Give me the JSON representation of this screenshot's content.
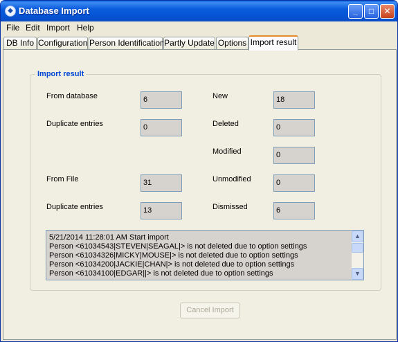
{
  "window": {
    "title": "Database Import"
  },
  "titlebar_buttons": {
    "minimize": "_",
    "maximize": "□",
    "close": "✕"
  },
  "menu": {
    "file": "File",
    "edit": "Edit",
    "import": "Import",
    "help": "Help"
  },
  "tabs": [
    "DB Info",
    "Configuration",
    "Person Identification",
    "Partly Update",
    "Options",
    "Import result"
  ],
  "active_tab": "Import result",
  "group": {
    "title": "Import result"
  },
  "fields": {
    "from_database": {
      "label": "From database",
      "value": "6"
    },
    "duplicate_db": {
      "label": "Duplicate entries",
      "value": "0"
    },
    "from_file": {
      "label": "From File",
      "value": "31"
    },
    "duplicate_file": {
      "label": "Duplicate entries",
      "value": "13"
    },
    "new": {
      "label": "New",
      "value": "18"
    },
    "deleted": {
      "label": "Deleted",
      "value": "0"
    },
    "modified": {
      "label": "Modified",
      "value": "0"
    },
    "unmodified": {
      "label": "Unmodified",
      "value": "0"
    },
    "dismissed": {
      "label": "Dismissed",
      "value": "6"
    }
  },
  "log": [
    "5/21/2014 11:28:01 AM Start import",
    "Person <61034543|STEVEN|SEAGAL|> is not deleted due to option settings",
    "Person <61034326|MICKY|MOUSE|> is not deleted due to option settings",
    "Person <61034200|JACKIE|CHAN|> is not deleted due to option settings",
    "Person <61034100|EDGAR||> is not deleted due to option settings"
  ],
  "buttons": {
    "cancel_import": "Cancel Import"
  },
  "icons": {
    "scroll_up": "▲",
    "scroll_down": "▼"
  },
  "colors": {
    "titlebar": "#0555d6",
    "group_title": "#0046d5",
    "active_tab_accent": "#e68b2c"
  }
}
